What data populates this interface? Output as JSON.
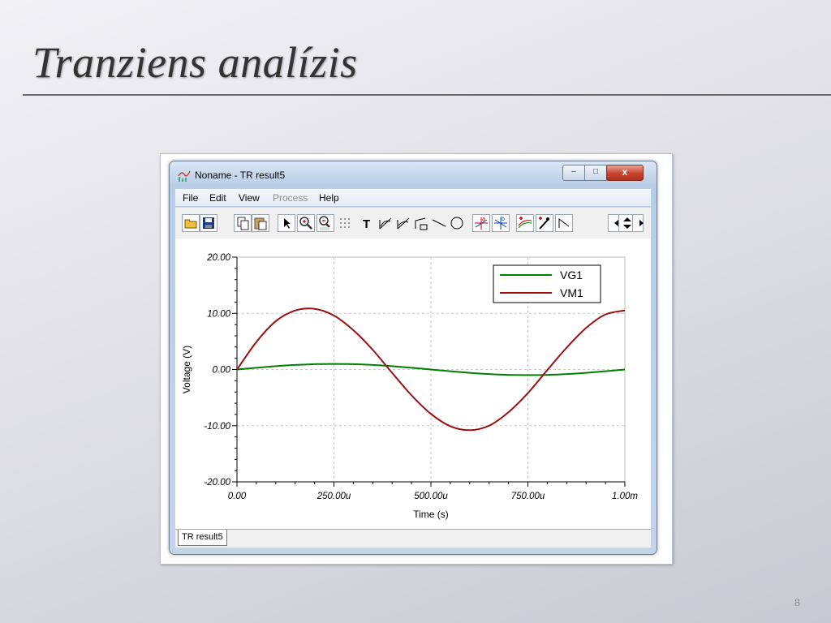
{
  "slide": {
    "title": "Tranziens analízis",
    "page_number": "8"
  },
  "window": {
    "title": "Noname - TR result5",
    "controls": {
      "minimize": "–",
      "maximize": "□",
      "close": "x"
    }
  },
  "menu": [
    {
      "label": "File",
      "enabled": true
    },
    {
      "label": "Edit",
      "enabled": true
    },
    {
      "label": "View",
      "enabled": true
    },
    {
      "label": "Process",
      "enabled": false
    },
    {
      "label": "Help",
      "enabled": true
    }
  ],
  "toolbar_icons": [
    "open-folder-icon",
    "save-icon",
    "copy-icon",
    "paste-icon",
    "pointer-icon",
    "zoom-in-icon",
    "zoom-100-icon",
    "grid-icon",
    "text-icon",
    "axis-a-icon",
    "axis-b-icon",
    "cursor-icon",
    "line-icon",
    "circle-icon",
    "cursor-a-icon",
    "cursor-b-icon",
    "add-curve-icon",
    "marker-icon",
    "corner-icon",
    "scroll-left-icon",
    "scroll-updown-icon",
    "scroll-right-icon"
  ],
  "tabs": [
    {
      "label": "TR result5",
      "active": true
    }
  ],
  "chart_data": {
    "type": "line",
    "xlabel": "Time (s)",
    "ylabel": "Voltage (V)",
    "xlim": [
      0,
      1.0
    ],
    "ylim": [
      -20,
      20
    ],
    "x_ticks": [
      0,
      0.25,
      0.5,
      0.75,
      1.0
    ],
    "x_tick_labels": [
      "0.00",
      "250.00u",
      "500.00u",
      "750.00u",
      "1.00m"
    ],
    "y_ticks": [
      20,
      10,
      0,
      -10,
      -20
    ],
    "y_tick_labels": [
      "20.00",
      "10.00",
      "0.00",
      "-10.00",
      "-20.00"
    ],
    "grid": true,
    "legend_position": "top-right",
    "x_unit": "ms",
    "series": [
      {
        "name": "VG1",
        "color": "#008000",
        "x": [
          0,
          0.05,
          0.1,
          0.15,
          0.2,
          0.25,
          0.3,
          0.35,
          0.4,
          0.45,
          0.5,
          0.55,
          0.6,
          0.65,
          0.7,
          0.75,
          0.8,
          0.85,
          0.9,
          0.95,
          1.0
        ],
        "y": [
          0,
          0.31,
          0.59,
          0.81,
          0.95,
          1.0,
          0.95,
          0.81,
          0.59,
          0.31,
          0,
          -0.31,
          -0.59,
          -0.81,
          -0.95,
          -1.0,
          -0.95,
          -0.81,
          -0.59,
          -0.31,
          0
        ]
      },
      {
        "name": "VM1",
        "color": "#9b1010",
        "x": [
          0,
          0.05,
          0.1,
          0.15,
          0.2,
          0.25,
          0.3,
          0.35,
          0.4,
          0.45,
          0.5,
          0.55,
          0.6,
          0.65,
          0.7,
          0.75,
          0.8,
          0.85,
          0.9,
          0.95,
          1.0
        ],
        "y": [
          0,
          4.9,
          8.6,
          10.5,
          10.8,
          9.6,
          7.0,
          3.5,
          -0.6,
          -4.6,
          -7.9,
          -10.1,
          -10.8,
          -10.0,
          -7.6,
          -4.2,
          -0.1,
          3.9,
          7.4,
          9.8,
          10.5
        ]
      }
    ]
  }
}
